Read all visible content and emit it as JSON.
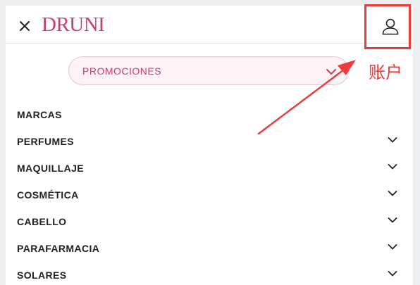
{
  "header": {
    "logo_text": "DRUNI",
    "close_icon": "close-icon",
    "account_icon": "user-icon"
  },
  "promo": {
    "label": "PROMOCIONES",
    "icon": "chevron-down-icon"
  },
  "menu": {
    "items": [
      {
        "label": "MARCAS",
        "has_chevron": false
      },
      {
        "label": "PERFUMES",
        "has_chevron": true
      },
      {
        "label": "MAQUILLAJE",
        "has_chevron": true
      },
      {
        "label": "COSMÉTICA",
        "has_chevron": true
      },
      {
        "label": "CABELLO",
        "has_chevron": true
      },
      {
        "label": "PARAFARMACIA",
        "has_chevron": true
      },
      {
        "label": "SOLARES",
        "has_chevron": true
      }
    ]
  },
  "annotation": {
    "label": "账户",
    "color": "#ee3b3b"
  },
  "colors": {
    "brand": "#c83f6b",
    "promo_background": "#fdf2f5",
    "promo_border": "#ecc4cf",
    "text": "#222222"
  }
}
